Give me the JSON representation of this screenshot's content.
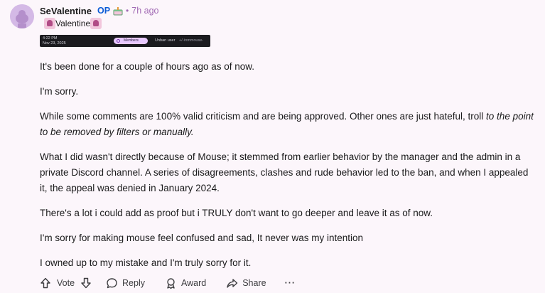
{
  "post": {
    "username": "SeValentine",
    "op_label": "OP",
    "time": "7h ago",
    "flair": "Valentine",
    "paragraphs": [
      "It's been done for a couple of hours ago as of now.",
      "I'm sorry.",
      "What I did wasn't directly because of Mouse; it stemmed from earlier behavior by the manager and the admin in a private Discord channel. A series of disagreements, clashes and rude behavior led to the ban, and when I appealed it, the appeal was denied in January 2024.",
      "There's a lot i could add as proof but i TRULY don't want to go deeper and leave it as of now.",
      "I'm sorry for making mouse feel confused and sad, It never was my intention",
      "I owned up to my mistake and I'm truly sorry for it."
    ],
    "criticism_plain": "While some comments are 100% valid criticism and are being approved. Other ones are just hateful, troll ",
    "criticism_italic": "to the point to be removed by filters or manually."
  },
  "screenshot": {
    "time": "4:22 PM",
    "date": "Nov 23, 2025",
    "members_label": "Members",
    "action": "Unban user",
    "user": "+/-ironmouse-"
  },
  "actions": {
    "vote": "Vote",
    "reply": "Reply",
    "award": "Award",
    "share": "Share",
    "more": "···"
  },
  "icons": {
    "avatar": "snoo-avatar",
    "op_badge": "cake-icon",
    "flair": "valentine-emoji-icon"
  },
  "colors": {
    "background": "#fcf6fb",
    "op": "#0a5bd6",
    "timestamp": "#a16ab4"
  }
}
